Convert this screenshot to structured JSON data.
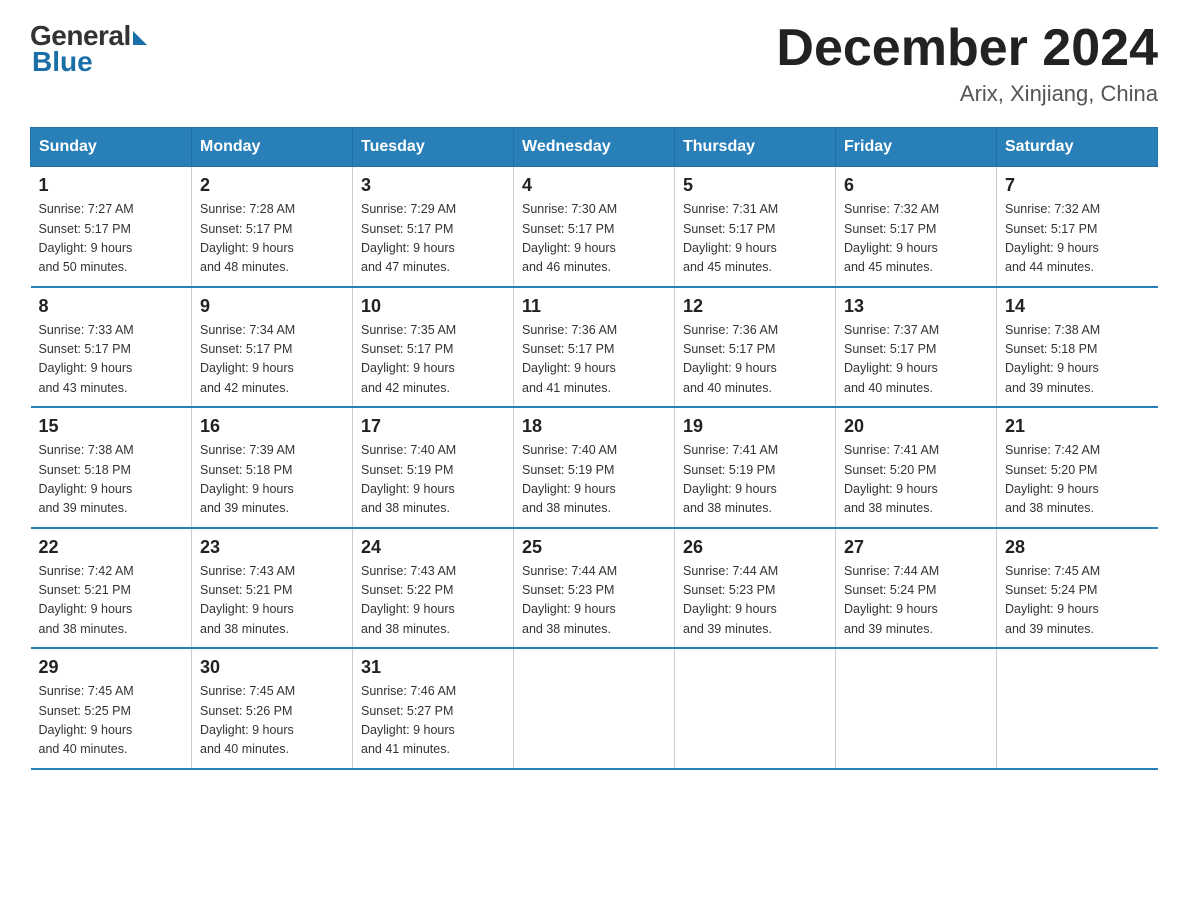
{
  "logo": {
    "general": "General",
    "blue": "Blue"
  },
  "header": {
    "month": "December 2024",
    "location": "Arix, Xinjiang, China"
  },
  "days_of_week": [
    "Sunday",
    "Monday",
    "Tuesday",
    "Wednesday",
    "Thursday",
    "Friday",
    "Saturday"
  ],
  "weeks": [
    [
      {
        "day": "1",
        "sunrise": "7:27 AM",
        "sunset": "5:17 PM",
        "daylight": "9 hours and 50 minutes."
      },
      {
        "day": "2",
        "sunrise": "7:28 AM",
        "sunset": "5:17 PM",
        "daylight": "9 hours and 48 minutes."
      },
      {
        "day": "3",
        "sunrise": "7:29 AM",
        "sunset": "5:17 PM",
        "daylight": "9 hours and 47 minutes."
      },
      {
        "day": "4",
        "sunrise": "7:30 AM",
        "sunset": "5:17 PM",
        "daylight": "9 hours and 46 minutes."
      },
      {
        "day": "5",
        "sunrise": "7:31 AM",
        "sunset": "5:17 PM",
        "daylight": "9 hours and 45 minutes."
      },
      {
        "day": "6",
        "sunrise": "7:32 AM",
        "sunset": "5:17 PM",
        "daylight": "9 hours and 45 minutes."
      },
      {
        "day": "7",
        "sunrise": "7:32 AM",
        "sunset": "5:17 PM",
        "daylight": "9 hours and 44 minutes."
      }
    ],
    [
      {
        "day": "8",
        "sunrise": "7:33 AM",
        "sunset": "5:17 PM",
        "daylight": "9 hours and 43 minutes."
      },
      {
        "day": "9",
        "sunrise": "7:34 AM",
        "sunset": "5:17 PM",
        "daylight": "9 hours and 42 minutes."
      },
      {
        "day": "10",
        "sunrise": "7:35 AM",
        "sunset": "5:17 PM",
        "daylight": "9 hours and 42 minutes."
      },
      {
        "day": "11",
        "sunrise": "7:36 AM",
        "sunset": "5:17 PM",
        "daylight": "9 hours and 41 minutes."
      },
      {
        "day": "12",
        "sunrise": "7:36 AM",
        "sunset": "5:17 PM",
        "daylight": "9 hours and 40 minutes."
      },
      {
        "day": "13",
        "sunrise": "7:37 AM",
        "sunset": "5:17 PM",
        "daylight": "9 hours and 40 minutes."
      },
      {
        "day": "14",
        "sunrise": "7:38 AM",
        "sunset": "5:18 PM",
        "daylight": "9 hours and 39 minutes."
      }
    ],
    [
      {
        "day": "15",
        "sunrise": "7:38 AM",
        "sunset": "5:18 PM",
        "daylight": "9 hours and 39 minutes."
      },
      {
        "day": "16",
        "sunrise": "7:39 AM",
        "sunset": "5:18 PM",
        "daylight": "9 hours and 39 minutes."
      },
      {
        "day": "17",
        "sunrise": "7:40 AM",
        "sunset": "5:19 PM",
        "daylight": "9 hours and 38 minutes."
      },
      {
        "day": "18",
        "sunrise": "7:40 AM",
        "sunset": "5:19 PM",
        "daylight": "9 hours and 38 minutes."
      },
      {
        "day": "19",
        "sunrise": "7:41 AM",
        "sunset": "5:19 PM",
        "daylight": "9 hours and 38 minutes."
      },
      {
        "day": "20",
        "sunrise": "7:41 AM",
        "sunset": "5:20 PM",
        "daylight": "9 hours and 38 minutes."
      },
      {
        "day": "21",
        "sunrise": "7:42 AM",
        "sunset": "5:20 PM",
        "daylight": "9 hours and 38 minutes."
      }
    ],
    [
      {
        "day": "22",
        "sunrise": "7:42 AM",
        "sunset": "5:21 PM",
        "daylight": "9 hours and 38 minutes."
      },
      {
        "day": "23",
        "sunrise": "7:43 AM",
        "sunset": "5:21 PM",
        "daylight": "9 hours and 38 minutes."
      },
      {
        "day": "24",
        "sunrise": "7:43 AM",
        "sunset": "5:22 PM",
        "daylight": "9 hours and 38 minutes."
      },
      {
        "day": "25",
        "sunrise": "7:44 AM",
        "sunset": "5:23 PM",
        "daylight": "9 hours and 38 minutes."
      },
      {
        "day": "26",
        "sunrise": "7:44 AM",
        "sunset": "5:23 PM",
        "daylight": "9 hours and 39 minutes."
      },
      {
        "day": "27",
        "sunrise": "7:44 AM",
        "sunset": "5:24 PM",
        "daylight": "9 hours and 39 minutes."
      },
      {
        "day": "28",
        "sunrise": "7:45 AM",
        "sunset": "5:24 PM",
        "daylight": "9 hours and 39 minutes."
      }
    ],
    [
      {
        "day": "29",
        "sunrise": "7:45 AM",
        "sunset": "5:25 PM",
        "daylight": "9 hours and 40 minutes."
      },
      {
        "day": "30",
        "sunrise": "7:45 AM",
        "sunset": "5:26 PM",
        "daylight": "9 hours and 40 minutes."
      },
      {
        "day": "31",
        "sunrise": "7:46 AM",
        "sunset": "5:27 PM",
        "daylight": "9 hours and 41 minutes."
      },
      null,
      null,
      null,
      null
    ]
  ],
  "labels": {
    "sunrise": "Sunrise:",
    "sunset": "Sunset:",
    "daylight": "Daylight:"
  }
}
